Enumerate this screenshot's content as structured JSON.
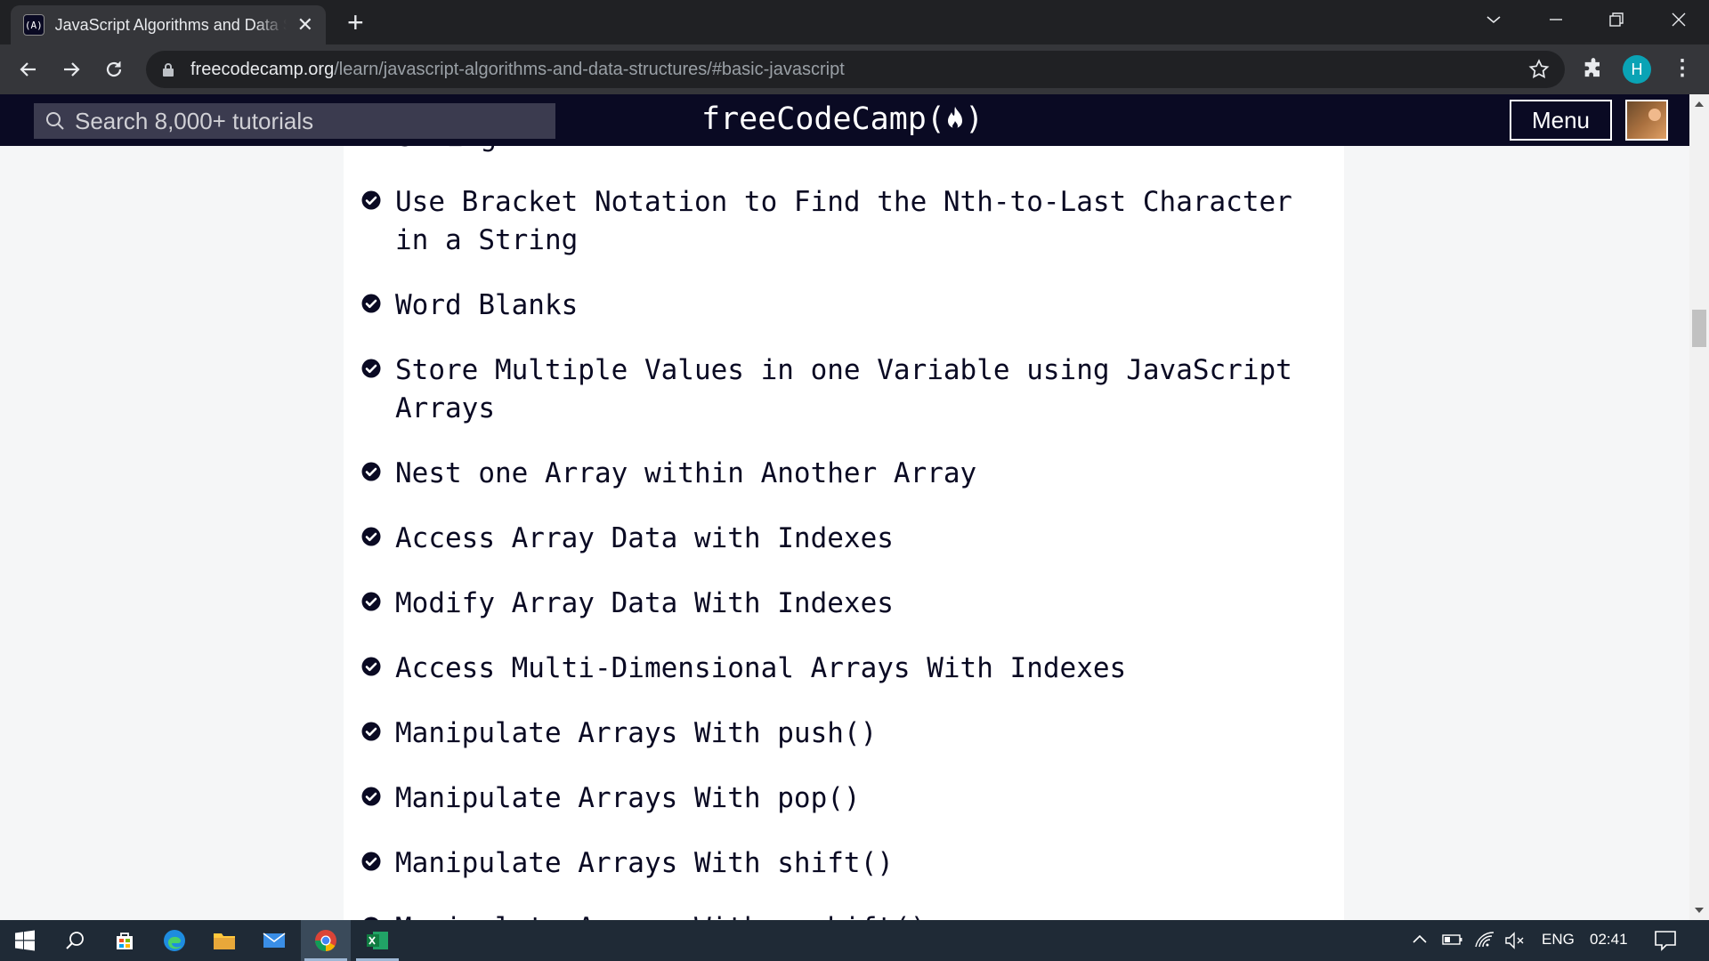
{
  "browser": {
    "tab_title": "JavaScript Algorithms and Data Structures",
    "tab_favicon": "(A)",
    "url_host": "freecodecamp.org",
    "url_path": "/learn/javascript-algorithms-and-data-structures/#basic-javascript",
    "profile_initial": "H",
    "window_controls": [
      "minimize",
      "restore",
      "close"
    ]
  },
  "site": {
    "search_placeholder": "Search 8,000+ tutorials",
    "logo": "freeCodeCamp(🔥)",
    "logo_text": "freeCodeCamp",
    "menu_label": "Menu"
  },
  "content": {
    "partial_top": "String",
    "lessons": [
      {
        "title": "Use Bracket Notation to Find the Nth-to-Last Character in a String",
        "completed": true
      },
      {
        "title": "Word Blanks",
        "completed": true
      },
      {
        "title": "Store Multiple Values in one Variable using JavaScript Arrays",
        "completed": true
      },
      {
        "title": "Nest one Array within Another Array",
        "completed": true
      },
      {
        "title": "Access Array Data with Indexes",
        "completed": true
      },
      {
        "title": "Modify Array Data With Indexes",
        "completed": true
      },
      {
        "title": "Access Multi-Dimensional Arrays With Indexes",
        "completed": true
      },
      {
        "title": "Manipulate Arrays With push()",
        "completed": true
      },
      {
        "title": "Manipulate Arrays With pop()",
        "completed": true
      },
      {
        "title": "Manipulate Arrays With shift()",
        "completed": true
      },
      {
        "title": "Manipulate Arrays With unshift()",
        "completed": true
      }
    ]
  },
  "taskbar": {
    "apps": [
      "start-icon",
      "search-icon",
      "store-icon",
      "edge-icon",
      "file-explorer-icon",
      "mail-icon",
      "chrome-icon",
      "excel-icon"
    ],
    "language": "ENG",
    "time": "02:41"
  },
  "colors": {
    "site_header": "#0a0a23",
    "browser_frame": "#35363a",
    "taskbar": "#1f2a36",
    "text": "#0a0a23"
  }
}
